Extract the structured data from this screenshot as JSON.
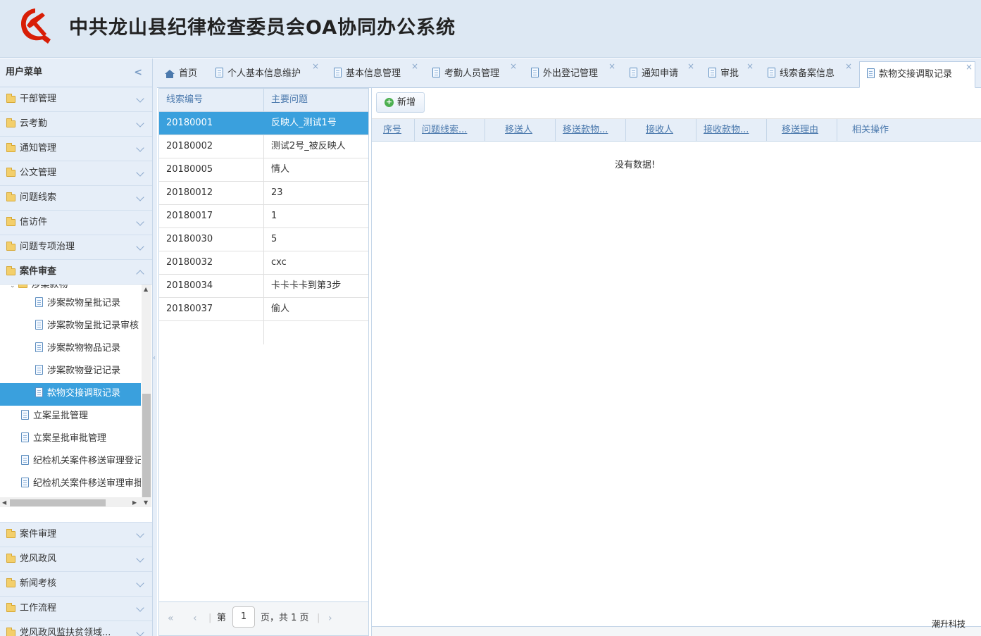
{
  "app": {
    "title": "中共龙山县纪律检查委员会OA协同办公系统",
    "company": "潮升科技"
  },
  "menu": {
    "title": "用户菜单",
    "collapse_icon": "chevron-left-icon",
    "sections_top": [
      {
        "label": "干部管理"
      },
      {
        "label": "云考勤"
      },
      {
        "label": "通知管理"
      },
      {
        "label": "公文管理"
      },
      {
        "label": "问题线索"
      },
      {
        "label": "信访件"
      },
      {
        "label": "问题专项治理"
      },
      {
        "label": "案件审查",
        "expanded": true
      }
    ],
    "tree": {
      "parent_label": "涉案款物",
      "children": [
        {
          "label": "涉案款物呈批记录"
        },
        {
          "label": "涉案款物呈批记录审核"
        },
        {
          "label": "涉案款物物品记录"
        },
        {
          "label": "涉案款物登记记录"
        },
        {
          "label": "款物交接调取记录",
          "selected": true
        }
      ],
      "siblings": [
        {
          "label": "立案呈批管理"
        },
        {
          "label": "立案呈批审批管理"
        },
        {
          "label": "纪检机关案件移送审理登记"
        },
        {
          "label": "纪检机关案件移送审理审批"
        }
      ]
    },
    "sections_bottom": [
      {
        "label": "案件审理"
      },
      {
        "label": "党风政风"
      },
      {
        "label": "新闻考核"
      },
      {
        "label": "工作流程"
      },
      {
        "label": "党风政风监扶贫领域..."
      }
    ]
  },
  "tabs": [
    {
      "label": "首页",
      "icon": "home-icon",
      "closable": false
    },
    {
      "label": "个人基本信息维护",
      "closable": true
    },
    {
      "label": "基本信息管理",
      "closable": true
    },
    {
      "label": "考勤人员管理",
      "closable": true
    },
    {
      "label": "外出登记管理",
      "closable": true
    },
    {
      "label": "通知申请",
      "closable": true
    },
    {
      "label": "审批",
      "closable": true
    },
    {
      "label": "线索备案信息",
      "closable": true
    },
    {
      "label": "款物交接调取记录",
      "closable": true,
      "active": true
    }
  ],
  "clue_grid": {
    "columns": [
      "线索编号",
      "主要问题"
    ],
    "rows": [
      {
        "id": "20180001",
        "issue": "反映人_测试1号",
        "selected": true
      },
      {
        "id": "20180002",
        "issue": "测试2号_被反映人"
      },
      {
        "id": "20180005",
        "issue": "情人"
      },
      {
        "id": "20180012",
        "issue": "23"
      },
      {
        "id": "20180017",
        "issue": "1"
      },
      {
        "id": "20180030",
        "issue": "5"
      },
      {
        "id": "20180032",
        "issue": "cxc"
      },
      {
        "id": "20180034",
        "issue": "卡卡卡卡到第3步"
      },
      {
        "id": "20180037",
        "issue": "偷人"
      }
    ],
    "pager": {
      "prefix": "第",
      "page": "1",
      "suffix": "页，共 1 页"
    }
  },
  "records": {
    "add_button": "新增",
    "columns": [
      "序号",
      "问题线索...",
      "移送人",
      "移送款物...",
      "接收人",
      "接收款物...",
      "移送理由",
      "相关操作"
    ],
    "empty_text": "没有数据!"
  },
  "colors": {
    "header_bg": "#dde8f3",
    "accent_blue": "#3aa0dd",
    "link_blue": "#4b79ad",
    "panel_bg": "#e6eef8"
  }
}
